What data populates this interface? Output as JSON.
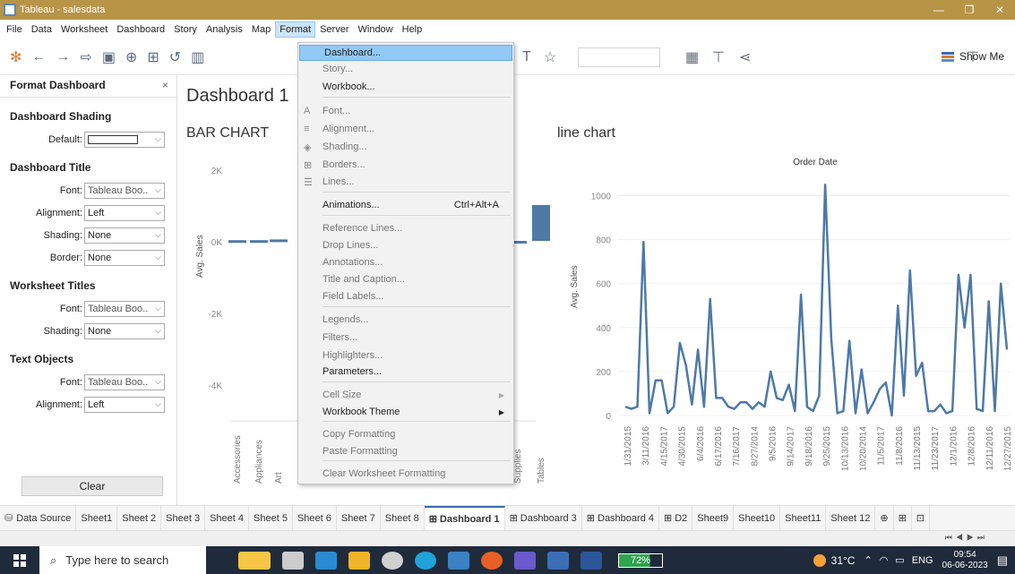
{
  "window": {
    "title": "Tableau - salesdata",
    "minimize": "—",
    "restore": "❐",
    "close": "✕"
  },
  "menubar": [
    "File",
    "Data",
    "Worksheet",
    "Dashboard",
    "Story",
    "Analysis",
    "Map",
    "Format",
    "Server",
    "Window",
    "Help"
  ],
  "toolbar": {
    "show_me": "Show Me"
  },
  "left_panel": {
    "header": "Format Dashboard",
    "close": "×",
    "shading": {
      "section": "Dashboard Shading",
      "label": "Default:"
    },
    "title": {
      "section": "Dashboard Title",
      "font_label": "Font:",
      "font_value": "Tableau Boo..",
      "align_label": "Alignment:",
      "align_value": "Left",
      "shading_label": "Shading:",
      "shading_value": "None",
      "border_label": "Border:",
      "border_value": "None"
    },
    "worksheet": {
      "section": "Worksheet Titles",
      "font_label": "Font:",
      "font_value": "Tableau Boo..",
      "shading_label": "Shading:",
      "shading_value": "None"
    },
    "text_objects": {
      "section": "Text Objects",
      "font_label": "Font:",
      "font_value": "Tableau Boo..",
      "align_label": "Alignment:",
      "align_value": "Left"
    },
    "clear": "Clear"
  },
  "dashboard": {
    "title": "Dashboard 1",
    "bar_title": "BAR CHART",
    "line_title": "line chart"
  },
  "format_menu": {
    "items": [
      {
        "label": "Dashboard...",
        "highlight": true
      },
      {
        "label": "Story...",
        "disabled": true
      },
      {
        "label": "Workbook..."
      },
      {
        "label": "Font...",
        "disabled": true,
        "icon": "A"
      },
      {
        "label": "Alignment...",
        "disabled": true,
        "icon": "≡"
      },
      {
        "label": "Shading...",
        "disabled": true,
        "icon": "◈"
      },
      {
        "label": "Borders...",
        "disabled": true,
        "icon": "⊞"
      },
      {
        "label": "Lines...",
        "disabled": true,
        "icon": "☰"
      },
      {
        "label": "Animations...",
        "shortcut": "Ctrl+Alt+A"
      },
      {
        "label": "Reference Lines...",
        "disabled": true
      },
      {
        "label": "Drop Lines...",
        "disabled": true
      },
      {
        "label": "Annotations...",
        "disabled": true
      },
      {
        "label": "Title and Caption...",
        "disabled": true
      },
      {
        "label": "Field Labels...",
        "disabled": true
      },
      {
        "label": "Legends...",
        "disabled": true
      },
      {
        "label": "Filters...",
        "disabled": true
      },
      {
        "label": "Highlighters...",
        "disabled": true
      },
      {
        "label": "Parameters..."
      },
      {
        "label": "Cell Size",
        "disabled": true,
        "submenu": true
      },
      {
        "label": "Workbook Theme",
        "submenu": true
      },
      {
        "label": "Copy Formatting",
        "disabled": true
      },
      {
        "label": "Paste Formatting",
        "disabled": true
      },
      {
        "label": "Clear Worksheet Formatting",
        "disabled": true
      }
    ]
  },
  "chart_data": [
    {
      "type": "bar",
      "title": "BAR CHART",
      "ylabel": "Avg. Sales",
      "ylim": [
        -5000,
        2000
      ],
      "yticks": [
        "2K",
        "0K",
        "-2K",
        "-4K"
      ],
      "categories": [
        "Accessories",
        "Appliances",
        "Art",
        "Supplies",
        "Tables"
      ],
      "values": [
        20,
        20,
        40,
        0,
        1000
      ],
      "color": "#4e79a7"
    },
    {
      "type": "line",
      "title": "line chart",
      "header": "Order Date",
      "ylabel": "Avg. Sales",
      "ylim": [
        0,
        1100
      ],
      "yticks": [
        "0",
        "200",
        "400",
        "600",
        "800",
        "1000"
      ],
      "xticks": [
        "1/31/2015",
        "3/11/2016",
        "4/15/2017",
        "4/30/2015",
        "6/4/2016",
        "6/17/2016",
        "7/16/2017",
        "8/27/2014",
        "9/5/2016",
        "9/14/2017",
        "9/18/2016",
        "9/25/2015",
        "10/13/2016",
        "10/20/2014",
        "11/5/2017",
        "11/8/2016",
        "11/13/2015",
        "11/23/2017",
        "12/1/2016",
        "12/8/2016",
        "12/11/2016",
        "12/27/2015"
      ],
      "values": [
        40,
        30,
        40,
        790,
        10,
        160,
        160,
        10,
        40,
        330,
        230,
        50,
        300,
        40,
        530,
        80,
        80,
        40,
        30,
        60,
        60,
        30,
        60,
        40,
        200,
        80,
        70,
        140,
        20,
        550,
        40,
        20,
        90,
        1050,
        350,
        10,
        20,
        340,
        10,
        210,
        10,
        60,
        120,
        150,
        0,
        500,
        90,
        660,
        180,
        240,
        20,
        20,
        50,
        10,
        20,
        640,
        400,
        640,
        30,
        20,
        520,
        20,
        600,
        300
      ],
      "color": "#4e79a7"
    }
  ],
  "tabs": [
    "Data Source",
    "Sheet1",
    "Sheet 2",
    "Sheet 3",
    "Sheet 4",
    "Sheet 5",
    "Sheet 6",
    "Sheet 7",
    "Sheet 8",
    "Dashboard 1",
    "Dashboard 3",
    "Dashboard 4",
    "D2",
    "Sheet9",
    "Sheet10",
    "Sheet11",
    "Sheet 12"
  ],
  "active_tab": "Dashboard 1",
  "taskbar": {
    "search_placeholder": "Type here to search",
    "battery": "72%",
    "weather": "31°C",
    "lang": "ENG",
    "time": "09:54",
    "date": "06-06-2023",
    "notif_count": "1"
  }
}
